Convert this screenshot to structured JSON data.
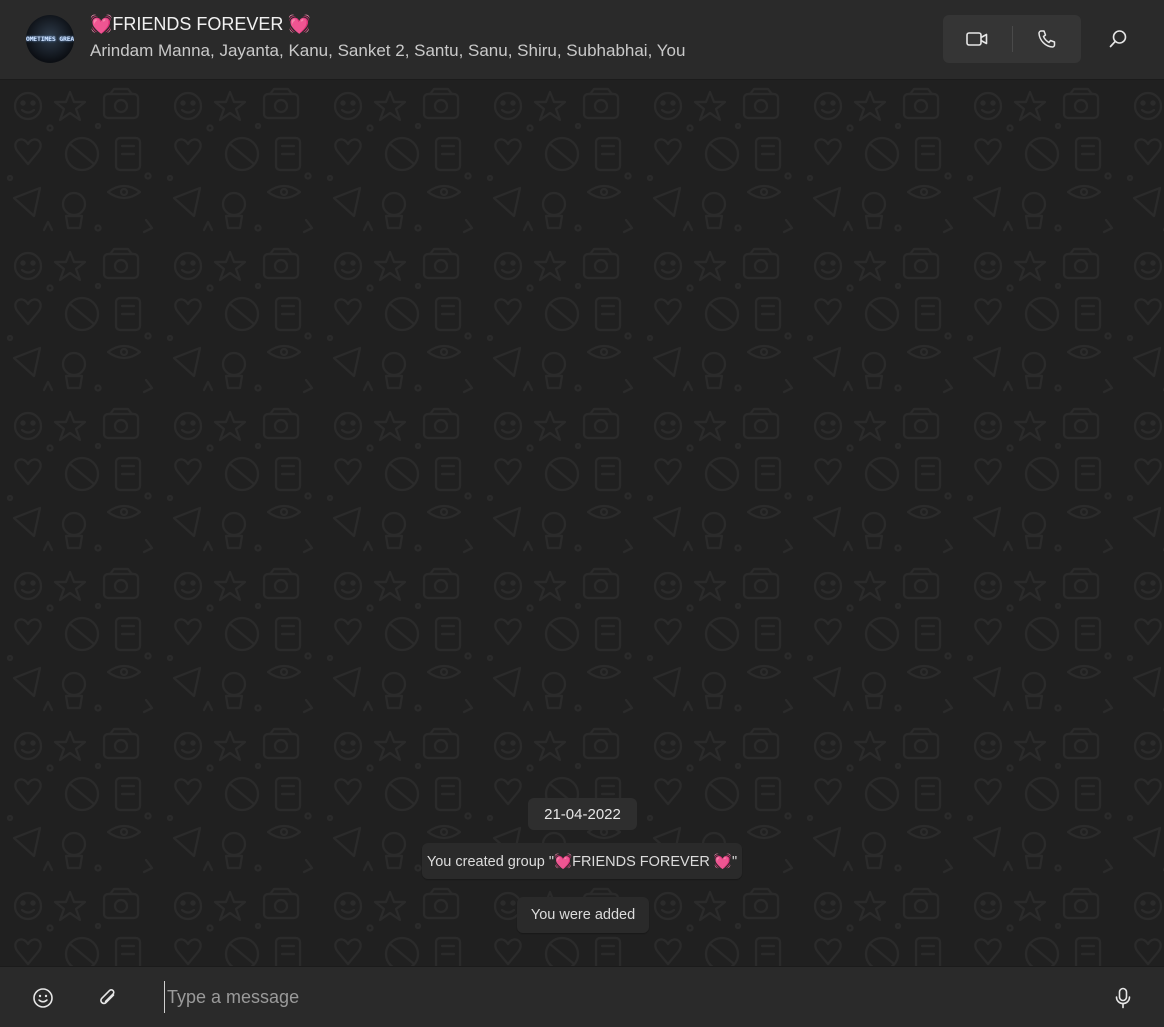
{
  "header": {
    "avatar_text": "SOMETIMES GREAT",
    "title": "💓FRIENDS FOREVER 💓",
    "participants": "Arindam Manna, Jayanta, Kanu, Sanket 2, Santu, Sanu, Shiru, Subhabhai, You",
    "video_icon": "video-camera-icon",
    "call_icon": "phone-icon",
    "search_icon": "search-icon"
  },
  "chat": {
    "date": "21-04-2022",
    "system_messages": [
      "You created group \"💓FRIENDS FOREVER 💓\"",
      "You were added"
    ]
  },
  "composer": {
    "placeholder": "Type a message",
    "emoji_icon": "emoji-icon",
    "attach_icon": "paperclip-icon",
    "mic_icon": "microphone-icon"
  },
  "colors": {
    "header_bg": "#2a2a2a",
    "chat_bg": "#202020",
    "bubble_bg": "#2e2e2e",
    "text": "#e9e9e9"
  }
}
